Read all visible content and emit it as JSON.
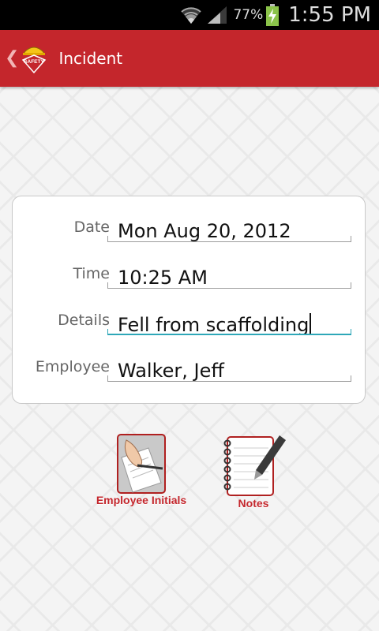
{
  "status_bar": {
    "battery_percent": "77%",
    "time": "1:55 PM"
  },
  "header": {
    "title": "Incident",
    "logo_text": "SAFETY"
  },
  "form": {
    "rows": [
      {
        "label": "Date",
        "value": "Mon Aug 20, 2012"
      },
      {
        "label": "Time",
        "value": "10:25 AM"
      },
      {
        "label": "Details",
        "value": "Fell from scaffolding",
        "focused": true
      },
      {
        "label": "Employee",
        "value": "Walker, Jeff"
      }
    ]
  },
  "actions": {
    "initials_label": "Employee Initials",
    "notes_label": "Notes"
  },
  "colors": {
    "brand_red": "#c4262c",
    "focus_accent": "#2ea7b8"
  },
  "icons": [
    "wifi-icon",
    "signal-icon",
    "battery-charging-icon",
    "back-chevron-icon",
    "safety-logo-icon",
    "signature-icon",
    "notepad-icon"
  ]
}
